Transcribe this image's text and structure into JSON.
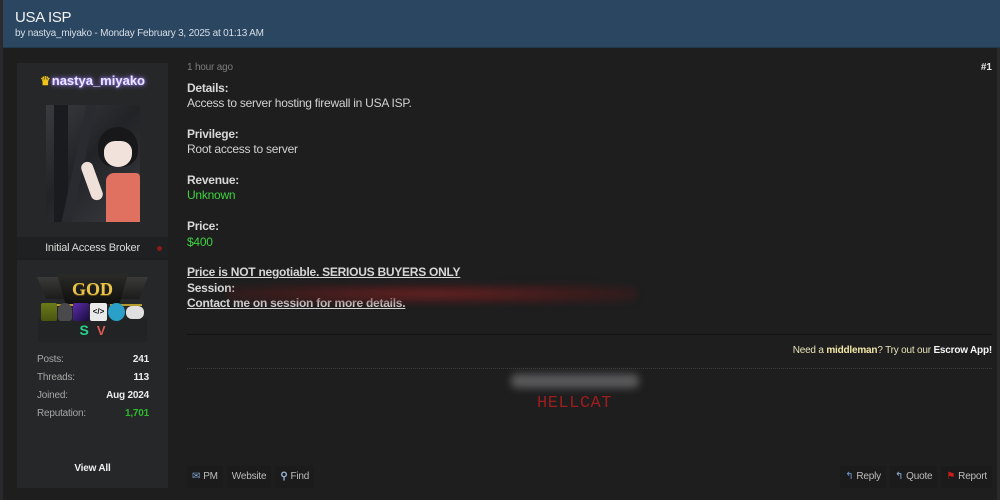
{
  "thread": {
    "title": "USA ISP",
    "byline": "by nastya_miyako - Monday February 3, 2025 at 01:13 AM"
  },
  "author": {
    "crown_icon": "crown-icon",
    "username": "nastya_miyako",
    "avatar": "anime-girl-avatar",
    "rank_title": "Initial Access Broker",
    "group_banner": "GOD",
    "badges": [
      {
        "glyph": "S",
        "color": "#25d48a"
      },
      {
        "glyph": "V",
        "color": "#e05a55"
      }
    ],
    "stats": [
      {
        "label": "Posts:",
        "value": "241"
      },
      {
        "label": "Threads:",
        "value": "113"
      },
      {
        "label": "Joined:",
        "value": "Aug 2024"
      },
      {
        "label": "Reputation:",
        "value": "1,701"
      }
    ],
    "awards": [
      "gift-award-icon",
      "hooded-figure-award-icon",
      "purple-box-award-icon",
      "code-award-icon",
      "monitor-award-icon",
      "gamepad-award-icon"
    ],
    "view_all_label": "View All"
  },
  "post": {
    "time": "1 hour ago",
    "number": "#1",
    "details_label": "Details:",
    "details_value": "Access to server hosting firewall in USA ISP.",
    "privilege_label": "Privilege:",
    "privilege_value": "Root access to server",
    "revenue_label": "Revenue:",
    "revenue_value": "Unknown",
    "price_label": "Price:",
    "price_value": "$400",
    "notice": "Price is NOT negotiable. SERIOUS BUYERS ONLY",
    "session_label": "Session:",
    "contact": "Contact me on session for more details."
  },
  "escrow": {
    "prefix": "Need a ",
    "middleman": "middleman",
    "middle": "? Try out our ",
    "app": "Escrow App!"
  },
  "signature": {
    "text": "HELLCAT"
  },
  "actions": {
    "left": [
      {
        "label": "PM",
        "icon": "mail-icon"
      },
      {
        "label": "Website",
        "icon": ""
      },
      {
        "label": "Find",
        "icon": "search-icon"
      }
    ],
    "right": [
      {
        "label": "Reply",
        "icon": "reply-icon"
      },
      {
        "label": "Quote",
        "icon": "quote-icon"
      },
      {
        "label": "Report",
        "icon": "flag-icon"
      }
    ]
  },
  "colors": {
    "header_bg": "#2a4660",
    "green": "#3ed23e",
    "reputation_green": "#2fb92f",
    "god_gold": "#e8c44d",
    "hellcat_red": "#9c1d1d"
  }
}
